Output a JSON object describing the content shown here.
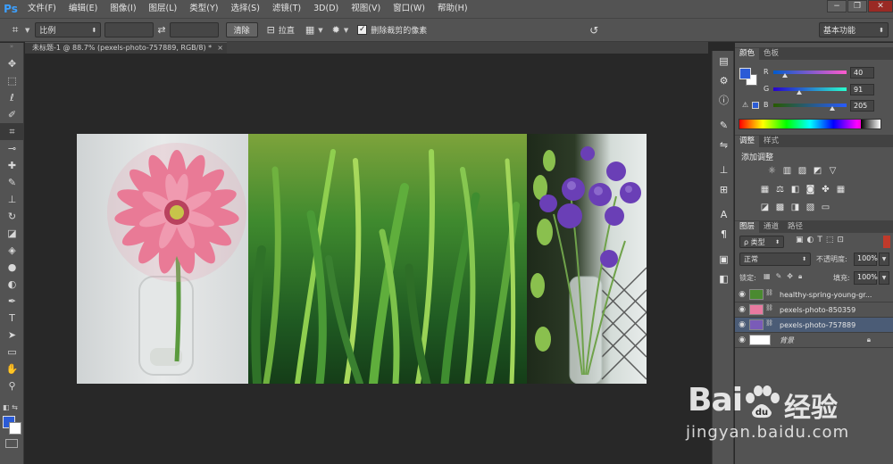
{
  "app": {
    "logo": "Ps"
  },
  "menu": [
    "文件(F)",
    "编辑(E)",
    "图像(I)",
    "图层(L)",
    "类型(Y)",
    "选择(S)",
    "滤镜(T)",
    "3D(D)",
    "视图(V)",
    "窗口(W)",
    "帮助(H)"
  ],
  "window_buttons": {
    "minimize": "−",
    "maximize": "❐",
    "close": "✕"
  },
  "options": {
    "tool_icon": "crop-icon",
    "ratio_select": "比例",
    "clear_button": "清除",
    "straighten_label": "拉直",
    "delete_cropped_label": "删除裁剪的像素",
    "delete_cropped_checked": true,
    "workspace": "基本功能"
  },
  "document": {
    "tab_title": "未标题-1 @ 88.7% (pexels-photo-757889, RGB/8) *",
    "close": "×"
  },
  "color_panel": {
    "tabs": [
      "颜色",
      "色板"
    ],
    "fg_color": "#2b5bd6",
    "sliders": [
      {
        "label": "R",
        "value": "40",
        "fraction": 0.157
      },
      {
        "label": "G",
        "value": "91",
        "fraction": 0.357
      },
      {
        "label": "B",
        "value": "205",
        "fraction": 0.804
      }
    ]
  },
  "adjust_panel": {
    "tabs": [
      "调整",
      "样式"
    ],
    "title": "添加调整"
  },
  "layers_panel": {
    "tabs": [
      "图层",
      "通道",
      "路径"
    ],
    "filter_label": "ρ 类型",
    "blend_mode": "正常",
    "opacity_label": "不透明度:",
    "opacity_value": "100%",
    "lock_label": "锁定:",
    "fill_label": "填充:",
    "fill_value": "100%",
    "layers": [
      {
        "name": "healthy-spring-young-gr...",
        "thumb": "#4a8a30",
        "selected": false
      },
      {
        "name": "pexels-photo-850359",
        "thumb": "#e87aa0",
        "selected": false
      },
      {
        "name": "pexels-photo-757889",
        "thumb": "#7a5bb8",
        "selected": true
      },
      {
        "name": "背景",
        "thumb": "#ffffff",
        "selected": false
      }
    ]
  },
  "watermark": {
    "brand_a": "Bai",
    "brand_b": "经验",
    "url": "jingyan.baidu.com"
  }
}
